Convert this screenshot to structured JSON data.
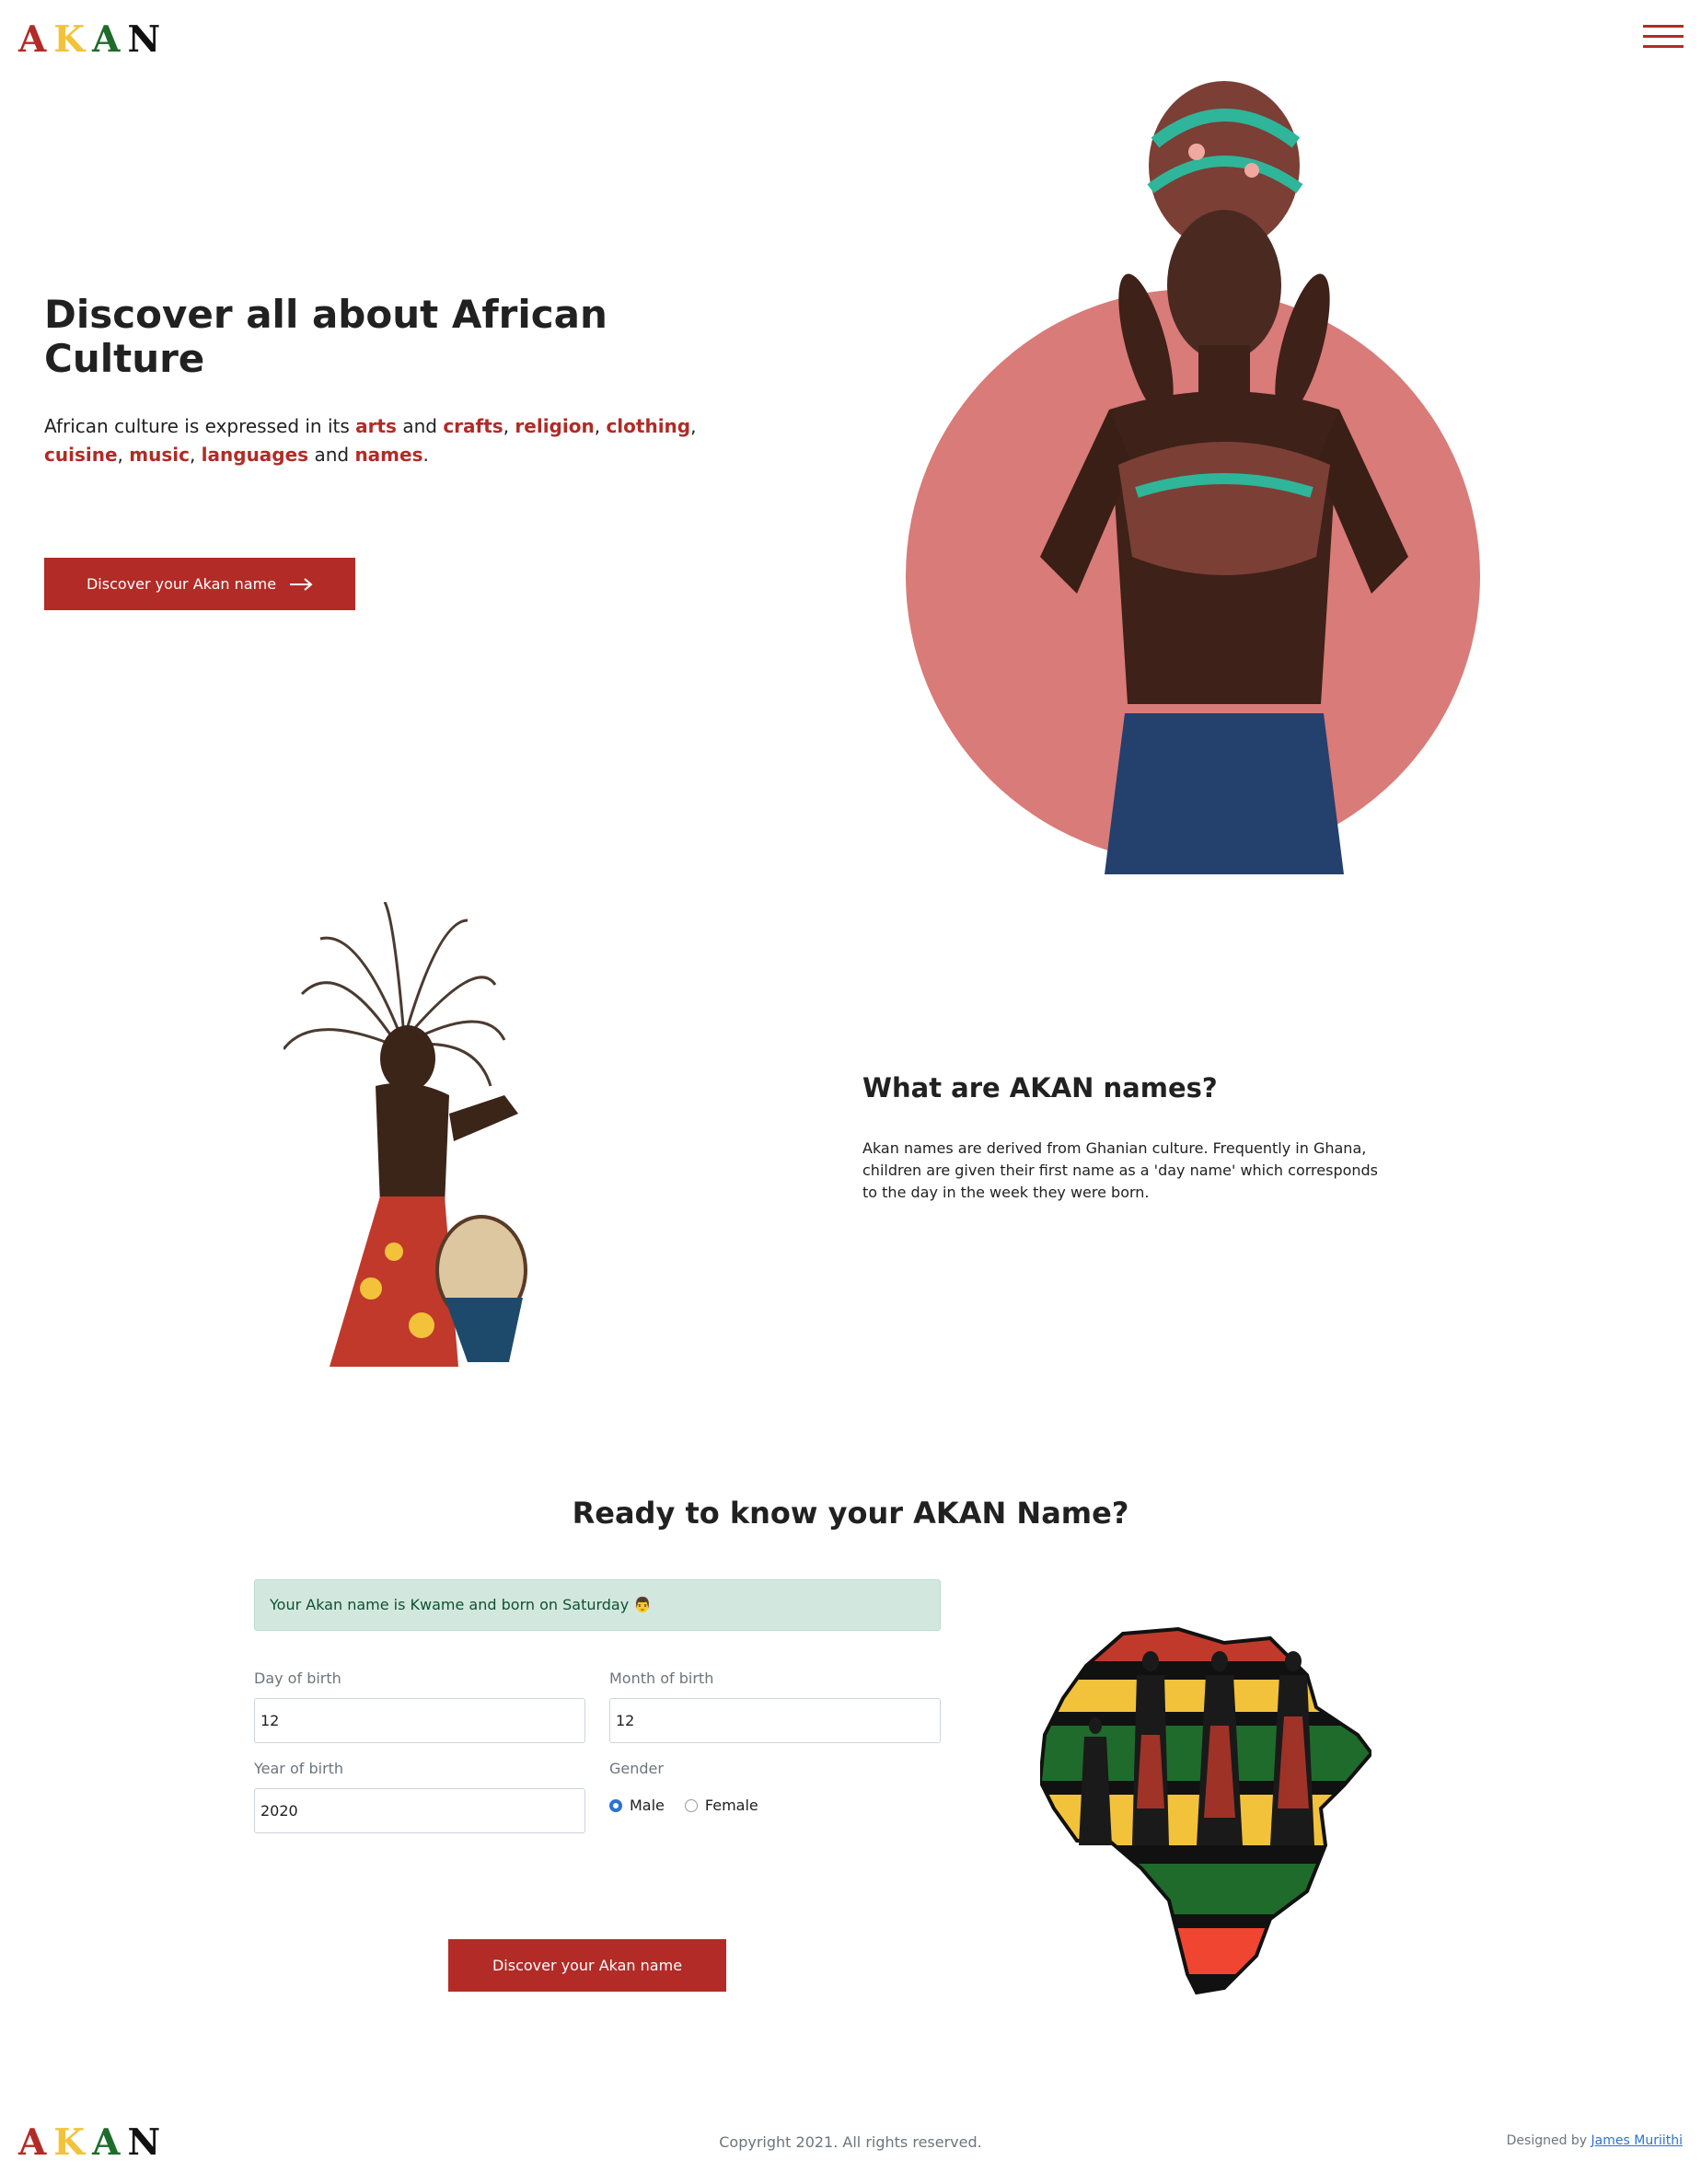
{
  "logo": {
    "letters": [
      "A",
      "K",
      "A",
      "N"
    ]
  },
  "nav": {
    "menu_icon": "hamburger-menu-icon"
  },
  "hero": {
    "title": "Discover all about African Culture",
    "text_intro": "African culture is expressed in its ",
    "highlights": [
      "arts",
      "crafts",
      "religion",
      "clothing",
      "cuisine",
      "music",
      "languages",
      "names"
    ],
    "text_and": " and ",
    "text_end": ".",
    "button_label": "Discover your Akan name",
    "button_icon": "arrow-right-icon"
  },
  "about": {
    "title": "What are AKAN names?",
    "text": "Akan names are derived from Ghanian culture. Frequently in Ghana, children are given their first name as a 'day name' which corresponds to the day in the week they were born."
  },
  "form": {
    "title": "Ready to know your AKAN Name?",
    "result": "Your Akan name is Kwame and born on Saturday 👨",
    "day_label": "Day of birth",
    "day_value": "12",
    "month_label": "Month of birth",
    "month_value": "12",
    "year_label": "Year of birth",
    "year_value": "2020",
    "gender_label": "Gender",
    "gender_options": [
      "Male",
      "Female"
    ],
    "gender_selected": "Male",
    "submit_label": "Discover your Akan name"
  },
  "footer": {
    "copyright": "Copyright 2021. All rights reserved.",
    "designed_by": "Designed by ",
    "designer": "James Muriithi"
  },
  "colors": {
    "accent": "#b22b26",
    "logo_a": "#b22b26",
    "logo_k": "#f2c33a",
    "logo_a2": "#1f6b2b",
    "logo_n": "#111111",
    "hero_circle": "#d97b78",
    "alert_bg": "#d2e8de"
  }
}
